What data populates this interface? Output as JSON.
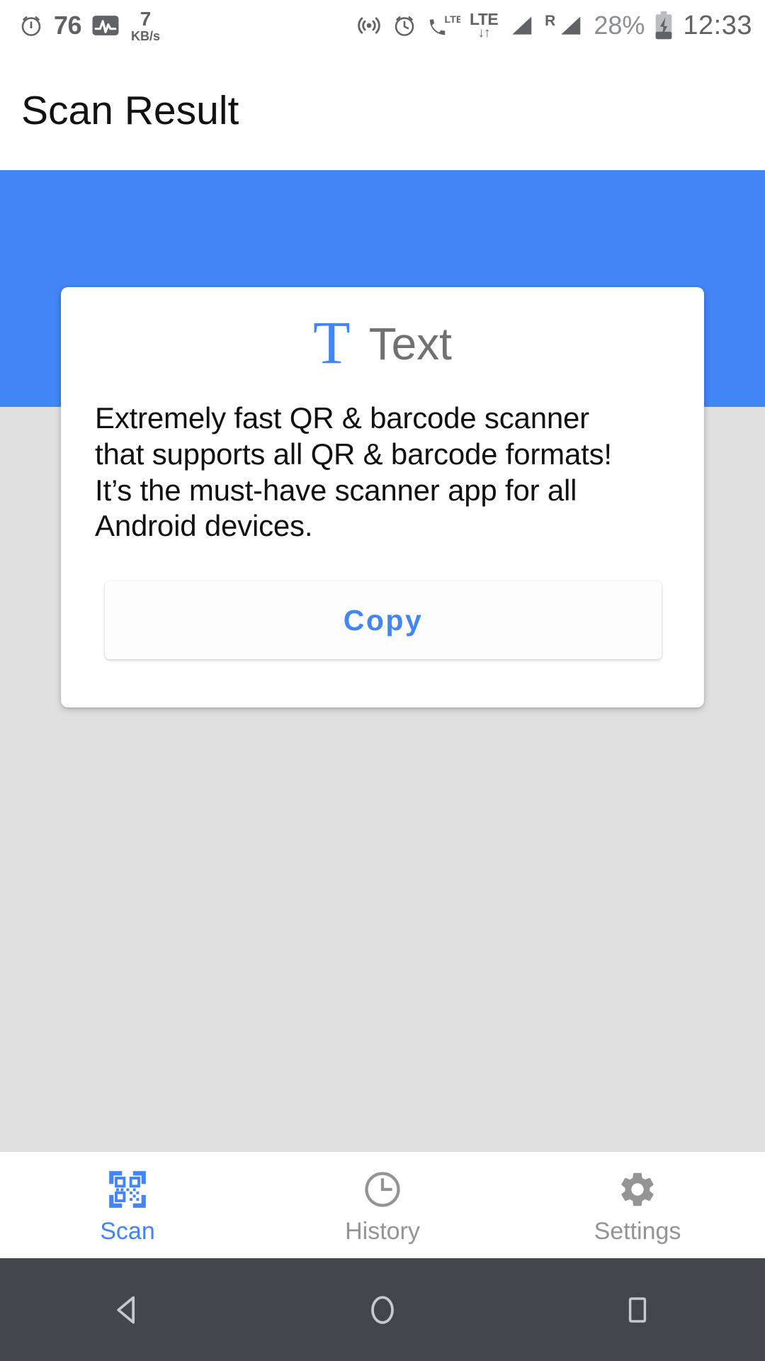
{
  "statusbar": {
    "left": {
      "alarm_icon": "alarm-clock-icon",
      "counter": "76",
      "activity_icon": "network-activity-icon",
      "netspeed_value": "7",
      "netspeed_unit": "KB/s"
    },
    "right": {
      "hotspot_icon": "hotspot-icon",
      "alarm_icon": "alarm-icon",
      "volte_icon": "volte-call-icon",
      "volte_label": "LTE",
      "data_label": "LTE",
      "data_arrows": "↓↑",
      "signal1_icon": "signal-bars-icon",
      "roaming_label": "R",
      "signal2_icon": "signal-bars-roaming-icon",
      "battery_percent": "28%",
      "battery_icon": "battery-charging-icon",
      "clock": "12:33"
    }
  },
  "appbar": {
    "title": "Scan Result"
  },
  "card": {
    "type_icon_glyph": "T",
    "type_icon_name": "text-type-icon",
    "type_label": "Text",
    "result_text": "Extremely fast QR & barcode scanner\nthat supports all QR & barcode formats!\nIt’s the must-have scanner app for all\nAndroid devices.",
    "copy_label": "Copy"
  },
  "bottomnav": {
    "items": [
      {
        "id": "scan",
        "label": "Scan",
        "icon": "qr-code-scan-icon",
        "active": true
      },
      {
        "id": "history",
        "label": "History",
        "icon": "clock-icon",
        "active": false
      },
      {
        "id": "settings",
        "label": "Settings",
        "icon": "gear-icon",
        "active": false
      }
    ]
  },
  "androidnav": {
    "back": "back-triangle-icon",
    "home": "home-circle-icon",
    "recents": "recents-square-icon"
  },
  "colors": {
    "accent": "#4285f4",
    "header_blue": "#4285f4",
    "page_bg": "#e0e0e0",
    "card_bg": "#ffffff",
    "nav_inactive": "#949494",
    "android_nav_bg": "#41474d",
    "status_icon": "#5f6368"
  }
}
